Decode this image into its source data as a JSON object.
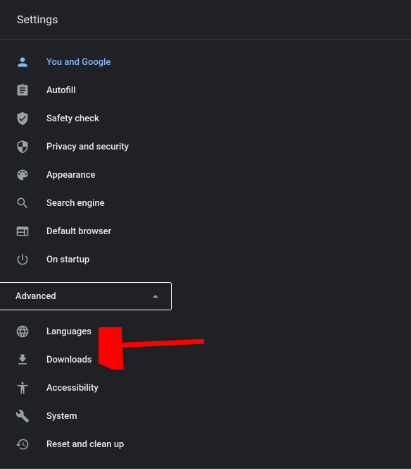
{
  "header": {
    "title": "Settings"
  },
  "nav": {
    "items": [
      {
        "id": "you-and-google",
        "label": "You and Google",
        "icon": "person",
        "active": true
      },
      {
        "id": "autofill",
        "label": "Autofill",
        "icon": "assignment",
        "active": false
      },
      {
        "id": "safety-check",
        "label": "Safety check",
        "icon": "verified-user",
        "active": false
      },
      {
        "id": "privacy-security",
        "label": "Privacy and security",
        "icon": "security",
        "active": false
      },
      {
        "id": "appearance",
        "label": "Appearance",
        "icon": "palette",
        "active": false
      },
      {
        "id": "search-engine",
        "label": "Search engine",
        "icon": "search",
        "active": false
      },
      {
        "id": "default-browser",
        "label": "Default browser",
        "icon": "web",
        "active": false
      },
      {
        "id": "on-startup",
        "label": "On startup",
        "icon": "power",
        "active": false
      }
    ]
  },
  "advanced": {
    "label": "Advanced",
    "expanded": true,
    "items": [
      {
        "id": "languages",
        "label": "Languages",
        "icon": "language"
      },
      {
        "id": "downloads",
        "label": "Downloads",
        "icon": "download"
      },
      {
        "id": "accessibility",
        "label": "Accessibility",
        "icon": "accessibility"
      },
      {
        "id": "system",
        "label": "System",
        "icon": "build"
      },
      {
        "id": "reset",
        "label": "Reset and clean up",
        "icon": "restore"
      }
    ]
  },
  "annotation": {
    "arrow_color": "#ff0000",
    "target": "downloads"
  }
}
